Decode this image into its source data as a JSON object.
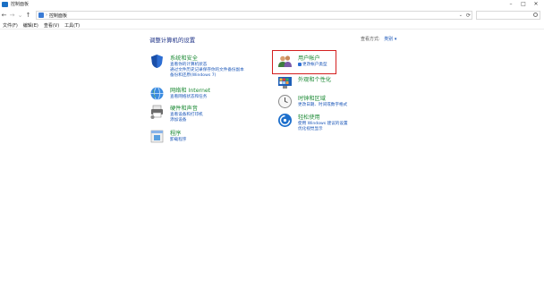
{
  "window": {
    "title": "控制面板",
    "min": "–",
    "max": "□",
    "close": "✕"
  },
  "nav": {
    "back": "←",
    "forward": "→",
    "down": "⌄",
    "up": "↑"
  },
  "address": {
    "separator": "›",
    "path": "控制面板",
    "dropdown": "⌄",
    "refresh": "⟳"
  },
  "menu": [
    "文件(F)",
    "编辑(E)",
    "查看(V)",
    "工具(T)"
  ],
  "main": {
    "title": "调整计算机的设置",
    "view_by_label": "查看方式:",
    "view_by_value": "类别 ▾"
  },
  "categories_left": [
    {
      "title": "系统和安全",
      "links": [
        "查看你的计算机状态",
        "通过文件历史记录保存你的文件备份副本",
        "备份和还原(Windows 7)"
      ]
    },
    {
      "title": "网络和 Internet",
      "links": [
        "查看网络状态和任务"
      ]
    },
    {
      "title": "硬件和声音",
      "links": [
        "查看设备和打印机",
        "添加设备"
      ]
    },
    {
      "title": "程序",
      "links": [
        "卸载程序"
      ]
    }
  ],
  "categories_right": [
    {
      "title": "用户帐户",
      "links": [
        "更改帐户类型"
      ]
    },
    {
      "title": "外观和个性化",
      "links": []
    },
    {
      "title": "时钟和区域",
      "links": [
        "更改日期、时间或数字格式"
      ]
    },
    {
      "title": "轻松使用",
      "links": [
        "使用 Windows 建议的设置",
        "优化视觉显示"
      ]
    }
  ],
  "colors": {
    "accent_title": "#1e3287",
    "category_green": "#1c8a35",
    "link_blue": "#1a56b8",
    "highlight_red": "#d42020"
  }
}
